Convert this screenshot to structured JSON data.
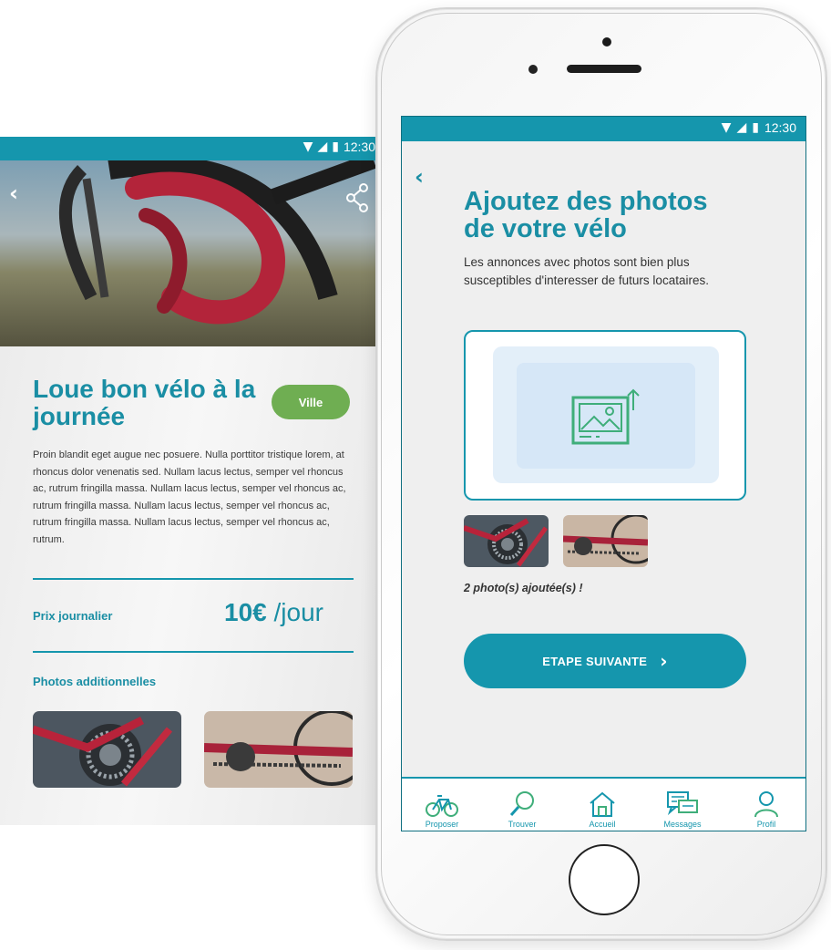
{
  "back_screen": {
    "status_time": "12:30",
    "title": "Loue bon vélo à la journée",
    "badge": "Ville",
    "description": "Proin blandit eget augue nec posuere. Nulla porttitor tristique lorem, at rhoncus dolor venenatis sed. Nullam lacus lectus, semper vel rhoncus ac, rutrum fringilla massa. Nullam lacus lectus, semper vel rhoncus ac, rutrum fringilla massa. Nullam lacus lectus, semper vel rhoncus ac, rutrum fringilla massa. Nullam lacus lectus, semper vel rhoncus ac, rutrum.",
    "price_label": "Prix journalier",
    "price_value": "10€",
    "price_unit": " /jour",
    "photos_label": "Photos additionnelles"
  },
  "front_screen": {
    "status_time": "12:30",
    "title": "Ajoutez des photos de votre vélo",
    "description": "Les annonces avec photos sont bien plus susceptibles d'interesser de futurs locataires.",
    "added_text": "2 photo(s) ajoutée(s) !",
    "next_button": "ETAPE SUIVANTE",
    "tabs": [
      {
        "label": "Proposer",
        "icon": "bike-icon"
      },
      {
        "label": "Trouver",
        "icon": "search-icon"
      },
      {
        "label": "Accueil",
        "icon": "home-icon"
      },
      {
        "label": "Messages",
        "icon": "messages-icon"
      },
      {
        "label": "Profil",
        "icon": "profile-icon"
      }
    ]
  },
  "colors": {
    "accent": "#1596ad",
    "badge_green": "#6fae52",
    "upload_green": "#3fae7a"
  }
}
